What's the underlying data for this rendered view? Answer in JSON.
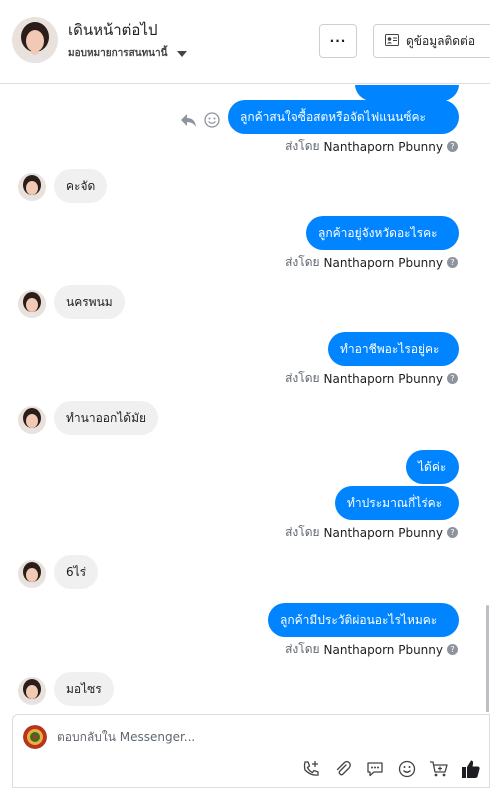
{
  "header": {
    "name": "เดินหน้าต่อไป",
    "assign_label": "มอบหมายการสนทนานี้",
    "more_label": "···",
    "contact_button_label": "ดูข้อมูลติดต่อ"
  },
  "messages": {
    "m1": "ลูกค้าสนใจซื้อสตหรือจัดไฟแนนซ์คะ",
    "m2": "คะจัด",
    "m3": "ลูกค้าอยู่จังหวัดอะไรคะ",
    "m4": "นครพนม",
    "m5": "ทำอาชีพอะไรอยู่คะ",
    "m6": "ทำนาออกได้มัย",
    "m7": "ได้ค่ะ",
    "m8": "ทำประมาณกี่ไร่คะ",
    "m9": "6ไร่",
    "m10": "ลูกค้ามีประวัติผ่อนอะไรไหมคะ",
    "m11": "มอไซร"
  },
  "sent_by": {
    "prefix": "ส่งโดย",
    "name": "Nanthaporn Pbunny",
    "help": "?"
  },
  "composer": {
    "placeholder": "ตอบกลับใน Messenger..."
  },
  "colors": {
    "outgoing_bubble": "#0084ff",
    "incoming_bubble": "#f0f0f0",
    "like_icon": "#1c1e21"
  },
  "icons": [
    "reply-icon",
    "emoji-react-icon",
    "add-call-icon",
    "attachment-icon",
    "saved-reply-icon",
    "emoji-icon",
    "cart-icon",
    "like-icon",
    "contact-card-icon"
  ]
}
